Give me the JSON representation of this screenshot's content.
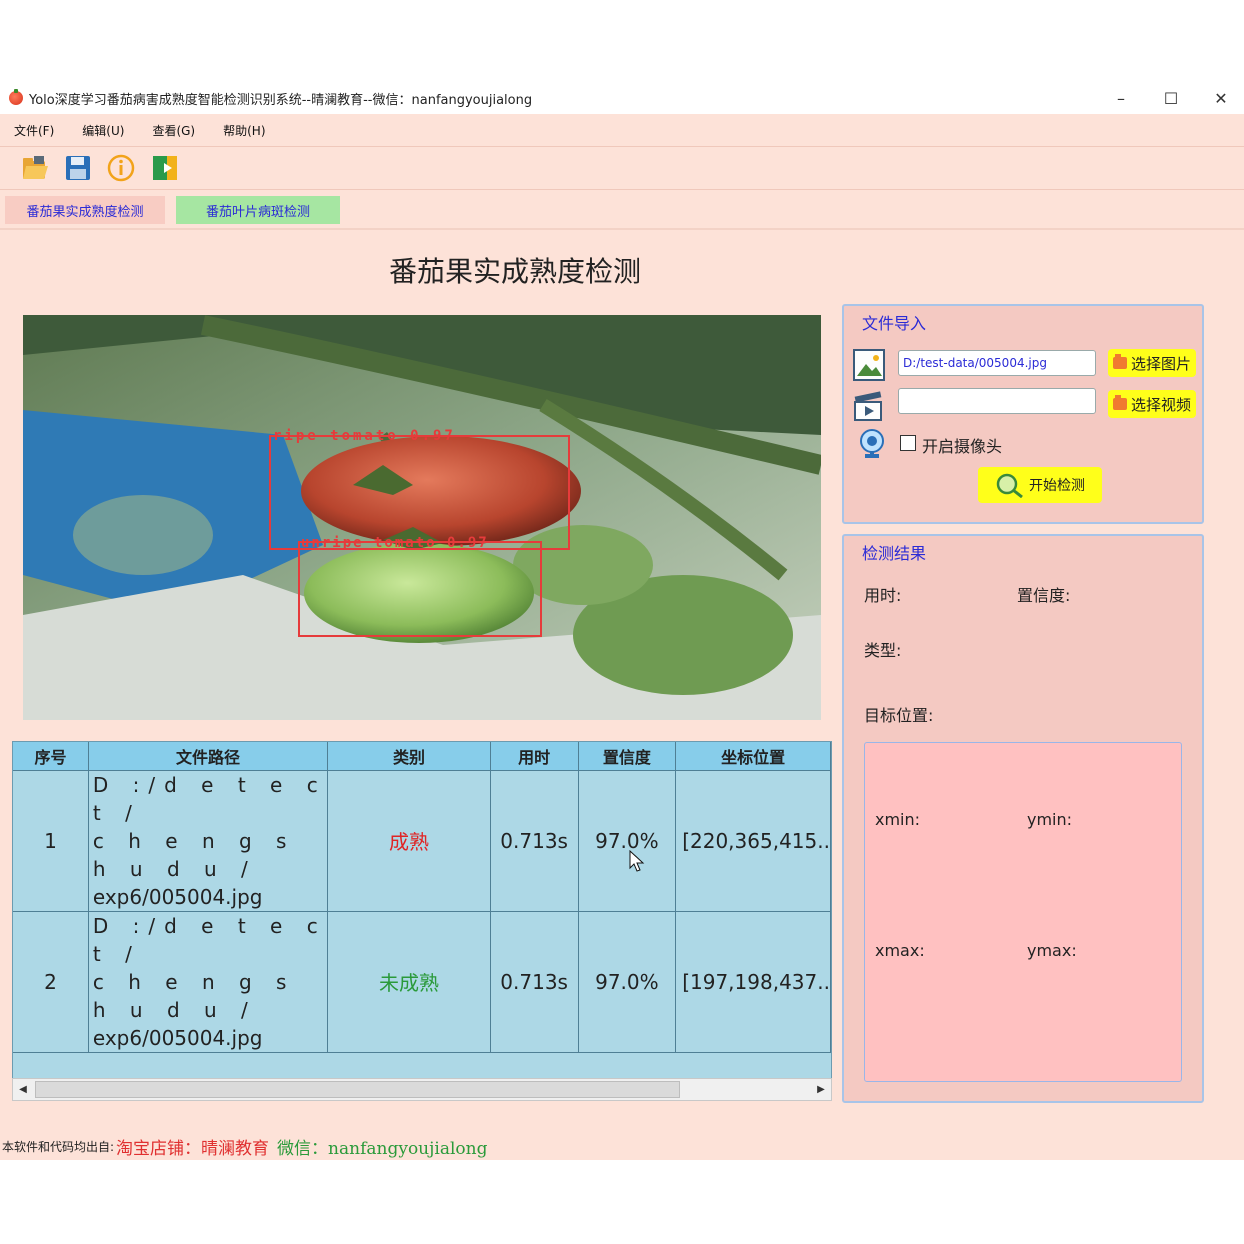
{
  "window": {
    "title": "Yolo深度学习番茄病害成熟度智能检测识别系统--晴澜教育--微信：nanfangyoujialong",
    "controls": {
      "minimize": "–",
      "maximize": "☐",
      "close": "✕"
    }
  },
  "menu": [
    "文件(F)",
    "编辑(U)",
    "查看(G)",
    "帮助(H)"
  ],
  "toolbar": [
    "folder-open-icon",
    "save-icon",
    "info-icon",
    "exit-icon"
  ],
  "tabs": [
    {
      "label": "番茄果实成熟度检测",
      "active": true
    },
    {
      "label": "番茄叶片病斑检测",
      "active": false
    }
  ],
  "page_title": "番茄果实成熟度检测",
  "image": {
    "detections": [
      {
        "label": "ripe tomato 0.97"
      },
      {
        "label": "unripe tomato 0.97"
      }
    ]
  },
  "table": {
    "headers": [
      "序号",
      "文件路径",
      "类别",
      "用时",
      "置信度",
      "坐标位置"
    ],
    "rows": [
      {
        "index": "1",
        "path_line1": "D :/d e t e c t /",
        "path_line2": "c h e n g s h u d u /",
        "path_line3": "exp6/005004.jpg",
        "category": "成熟",
        "category_color": "#e02424",
        "time": "0.713s",
        "confidence": "97.0%",
        "coords": "[220,365,415.."
      },
      {
        "index": "2",
        "path_line1": "D :/d e t e c t /",
        "path_line2": "c h e n g s h u d u /",
        "path_line3": "exp6/005004.jpg",
        "category": "未成熟",
        "category_color": "#2a9a3a",
        "time": "0.713s",
        "confidence": "97.0%",
        "coords": "[197,198,437.."
      }
    ]
  },
  "file_import": {
    "title": "文件导入",
    "image_path": "D:/test-data/005004.jpg",
    "video_path": "",
    "select_image": "选择图片",
    "select_video": "选择视频",
    "camera_label": "开启摄像头",
    "camera_checked": false,
    "start_button": "开始检测"
  },
  "result": {
    "title": "检测结果",
    "time_label": "用时:",
    "confidence_label": "置信度:",
    "type_label": "类型:",
    "position_label": "目标位置:",
    "xmin_label": "xmin:",
    "ymin_label": "ymin:",
    "xmax_label": "xmax:",
    "ymax_label": "ymax:"
  },
  "footer": {
    "prefix": "本软件和代码均出自:",
    "shop": "淘宝店铺：晴澜教育",
    "wechat": "微信：nanfangyoujialong"
  },
  "colors": {
    "background": "#fde2d8",
    "accent_blue": "#2b2bd6",
    "button_yellow": "#ffff1a",
    "table_blue": "#add8e6",
    "header_blue": "#87cdea"
  }
}
